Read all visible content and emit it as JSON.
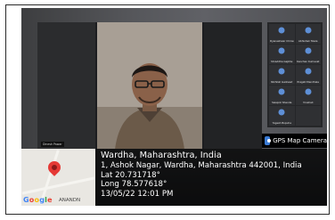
{
  "meeting": {
    "presenter_label": "Dinesh Pawar",
    "participants": [
      {
        "name": "Dyaneshwar Chinwe"
      },
      {
        "name": "Abhishek Tawle"
      },
      {
        "name": "Shraddha Gajbhe"
      },
      {
        "name": "Kanchan Kumavat"
      },
      {
        "name": "Nikhilsh Gaikwad"
      },
      {
        "name": "Pragati Mendhale"
      },
      {
        "name": "Swapnil Shende"
      },
      {
        "name": "Vrushali"
      },
      {
        "name": "Yogesh Bopuhe"
      },
      {
        "name": ""
      }
    ]
  },
  "stamp": {
    "badge_label": "GPS Map Camera",
    "title": "Wardha, Maharashtra, India",
    "address": "1, Ashok Nagar, Wardha, Maharashtra 442001, India",
    "lat": "Lat 20.731718°",
    "long": "Long 78.577618°",
    "datetime": "13/05/22 12:01 PM"
  },
  "map": {
    "logo_text": "Google",
    "place_label": "ANANDN"
  },
  "colors": {
    "pin": "#e53935",
    "badge_icon": "#3a7bd5",
    "avatar": "#5e8fd6"
  }
}
